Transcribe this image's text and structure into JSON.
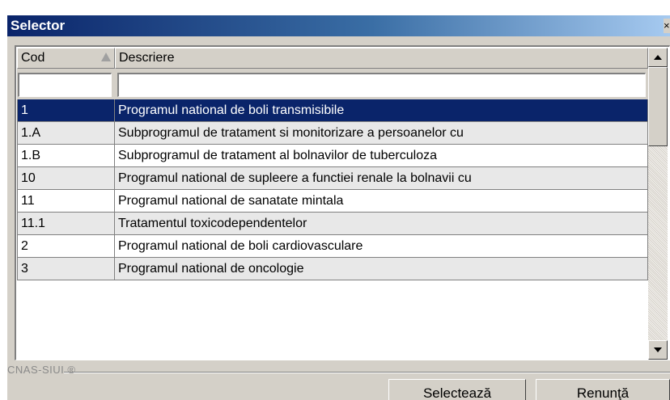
{
  "window": {
    "title": "Selector",
    "close_glyph": "×"
  },
  "grid": {
    "columns": [
      {
        "label": "Cod",
        "sorted": "ascending"
      },
      {
        "label": "Descriere"
      }
    ],
    "filters": {
      "cod": "",
      "descriere": ""
    },
    "rows": [
      {
        "cod": "1",
        "descriere": "Programul national de boli transmisibile",
        "selected": true
      },
      {
        "cod": "1.A",
        "descriere": "Subprogramul de tratament si monitorizare a persoanelor cu"
      },
      {
        "cod": "1.B",
        "descriere": "Subprogramul de tratament al bolnavilor de tuberculoza"
      },
      {
        "cod": "10",
        "descriere": "Programul national de supleere a functiei renale la bolnavii cu"
      },
      {
        "cod": "11",
        "descriere": "Programul national de sanatate mintala"
      },
      {
        "cod": "11.1",
        "descriere": "Tratamentul toxicodependentelor"
      },
      {
        "cod": "2",
        "descriere": "Programul national de boli cardiovasculare"
      },
      {
        "cod": "3",
        "descriere": "Programul national de oncologie"
      }
    ]
  },
  "footer": {
    "brand": "CNAS-SIUI ®",
    "select_label": "Selectează",
    "cancel_label": "Renunţă"
  },
  "icons": {
    "sort": "sort-ascending-icon",
    "scroll_up": "arrow-up-icon",
    "scroll_down": "arrow-down-icon"
  },
  "colors": {
    "title_bar_start": "#0a246a",
    "title_bar_end": "#a6caf0",
    "selection": "#0a246a",
    "face": "#d4d0c8"
  }
}
